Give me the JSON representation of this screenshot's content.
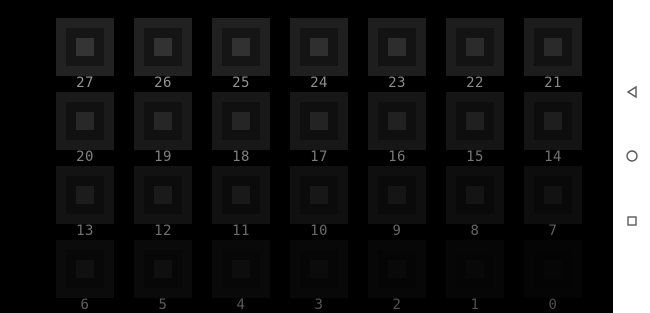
{
  "grid": {
    "rows": [
      [
        "27",
        "26",
        "25",
        "24",
        "23",
        "22",
        "21"
      ],
      [
        "20",
        "19",
        "18",
        "17",
        "16",
        "15",
        "14"
      ],
      [
        "13",
        "12",
        "11",
        "10",
        "9",
        "8",
        "7"
      ],
      [
        "6",
        "5",
        "4",
        "3",
        "2",
        "1",
        "0"
      ]
    ]
  },
  "navbar": {
    "items": [
      {
        "name": "back-button",
        "icon": "triangle-left-icon"
      },
      {
        "name": "home-button",
        "icon": "circle-icon"
      },
      {
        "name": "recents-button",
        "icon": "square-icon"
      }
    ],
    "icon_color": "#5a5a5a"
  }
}
